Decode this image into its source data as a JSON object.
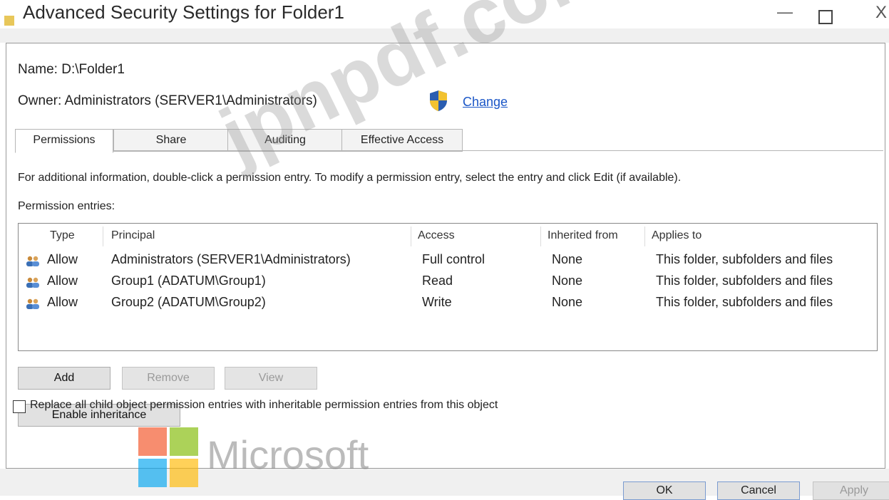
{
  "window": {
    "title": "Advanced Security Settings for Folder1",
    "controls": {
      "minimize": "—",
      "close": "X"
    }
  },
  "info": {
    "name_line": "Name: D:\\Folder1",
    "owner_line": "Owner: Administrators (SERVER1\\Administrators)",
    "change_link": "Change"
  },
  "tabs": [
    {
      "label": "Permissions"
    },
    {
      "label": "Share"
    },
    {
      "label": "Auditing"
    },
    {
      "label": "Effective Access"
    }
  ],
  "hint_text": "For additional information, double-click a permission entry. To modify a permission entry, select the entry and click Edit (if available).",
  "entries_label": "Permission entries:",
  "table": {
    "columns": [
      "Type",
      "Principal",
      "Access",
      "Inherited from",
      "Applies to"
    ],
    "rows": [
      {
        "type": "Allow",
        "principal": "Administrators (SERVER1\\Administrators)",
        "access": "Full control",
        "inherited": "None",
        "applies": "This folder, subfolders and files"
      },
      {
        "type": "Allow",
        "principal": "Group1 (ADATUM\\Group1)",
        "access": "Read",
        "inherited": "None",
        "applies": "This folder, subfolders and files"
      },
      {
        "type": "Allow",
        "principal": "Group2 (ADATUM\\Group2)",
        "access": "Write",
        "inherited": "None",
        "applies": "This folder, subfolders and files"
      }
    ]
  },
  "buttons": {
    "add": "Add",
    "remove": "Remove",
    "view": "View",
    "enable_inheritance": "Enable inheritance",
    "ok": "OK",
    "cancel": "Cancel",
    "apply": "Apply"
  },
  "replace_checkbox": {
    "label": "Replace all child object permission entries with inheritable permission entries from this object",
    "checked": false
  },
  "watermark": "jpnpdf.com",
  "ms_logo": {
    "text": "Microsoft",
    "colors": [
      "#f25022",
      "#7fba00",
      "#00a4ef",
      "#ffb900"
    ]
  },
  "colors": {
    "link": "#1a56c7",
    "border": "#888888"
  }
}
